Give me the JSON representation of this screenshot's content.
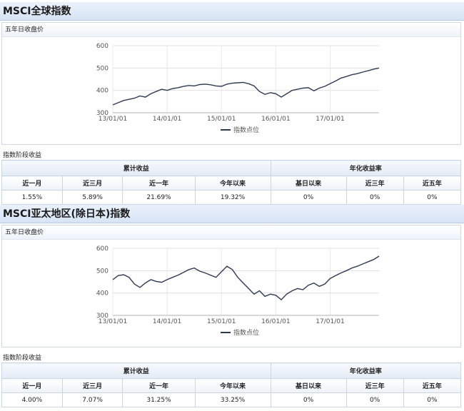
{
  "panels": [
    {
      "title": "MSCI全球指数",
      "chart_title": "五年日收盘价",
      "legend": "指数点位",
      "stage_label": "指数阶段收益",
      "group_cum": "累计收益",
      "group_ann": "年化收益率",
      "headers": [
        "近一月",
        "近三月",
        "近一年",
        "今年以来",
        "基日以来",
        "近三年",
        "近五年"
      ],
      "values": [
        "1.55%",
        "5.89%",
        "21.69%",
        "19.32%",
        "0%",
        "0%",
        "0%"
      ]
    },
    {
      "title": "MSCI亚太地区(除日本)指数",
      "chart_title": "五年日收盘价",
      "legend": "指数点位",
      "stage_label": "指数阶段收益",
      "group_cum": "累计收益",
      "group_ann": "年化收益率",
      "headers": [
        "近一月",
        "近三月",
        "近一年",
        "今年以来",
        "基日以来",
        "近三年",
        "近五年"
      ],
      "values": [
        "4.00%",
        "7.07%",
        "31.25%",
        "33.25%",
        "0%",
        "0%",
        "0%"
      ]
    }
  ],
  "chart_data": [
    {
      "type": "line",
      "title": "五年日收盘价",
      "series_name": "指数点位",
      "ylim": [
        300,
        600
      ],
      "yticks": [
        "300",
        "400",
        "500",
        "600"
      ],
      "xticks": [
        "13/01/01",
        "14/01/01",
        "15/01/01",
        "16/01/01",
        "17/01/01"
      ],
      "xlim": [
        2013.0,
        2017.9
      ],
      "x": [
        2013.0,
        2013.1,
        2013.2,
        2013.3,
        2013.4,
        2013.5,
        2013.6,
        2013.7,
        2013.8,
        2013.9,
        2014.0,
        2014.1,
        2014.2,
        2014.3,
        2014.4,
        2014.5,
        2014.6,
        2014.7,
        2014.8,
        2014.9,
        2015.0,
        2015.1,
        2015.2,
        2015.3,
        2015.4,
        2015.5,
        2015.6,
        2015.7,
        2015.8,
        2015.9,
        2016.0,
        2016.1,
        2016.2,
        2016.3,
        2016.4,
        2016.5,
        2016.6,
        2016.7,
        2016.8,
        2016.9,
        2017.0,
        2017.1,
        2017.2,
        2017.3,
        2017.4,
        2017.5,
        2017.6,
        2017.7,
        2017.8,
        2017.9
      ],
      "y": [
        335,
        345,
        355,
        360,
        365,
        375,
        370,
        385,
        395,
        405,
        400,
        408,
        412,
        418,
        422,
        420,
        426,
        428,
        425,
        420,
        418,
        428,
        432,
        434,
        436,
        430,
        420,
        395,
        382,
        390,
        385,
        370,
        385,
        400,
        405,
        410,
        412,
        398,
        410,
        418,
        430,
        442,
        455,
        462,
        470,
        475,
        482,
        488,
        495,
        500
      ]
    },
    {
      "type": "line",
      "title": "五年日收盘价",
      "series_name": "指数点位",
      "ylim": [
        300,
        600
      ],
      "yticks": [
        "300",
        "400",
        "500",
        "600"
      ],
      "xticks": [
        "13/01/01",
        "14/01/01",
        "15/01/01",
        "16/01/01",
        "17/01/01"
      ],
      "xlim": [
        2013.0,
        2017.9
      ],
      "x": [
        2013.0,
        2013.1,
        2013.2,
        2013.3,
        2013.4,
        2013.5,
        2013.6,
        2013.7,
        2013.8,
        2013.9,
        2014.0,
        2014.1,
        2014.2,
        2014.3,
        2014.4,
        2014.5,
        2014.6,
        2014.7,
        2014.8,
        2014.9,
        2015.0,
        2015.1,
        2015.2,
        2015.3,
        2015.4,
        2015.5,
        2015.6,
        2015.7,
        2015.8,
        2015.9,
        2016.0,
        2016.1,
        2016.2,
        2016.3,
        2016.4,
        2016.5,
        2016.6,
        2016.7,
        2016.8,
        2016.9,
        2017.0,
        2017.1,
        2017.2,
        2017.3,
        2017.4,
        2017.5,
        2017.6,
        2017.7,
        2017.8,
        2017.9
      ],
      "y": [
        460,
        478,
        482,
        470,
        440,
        425,
        445,
        460,
        452,
        448,
        460,
        470,
        480,
        492,
        505,
        512,
        498,
        490,
        480,
        470,
        495,
        520,
        505,
        470,
        445,
        420,
        395,
        410,
        385,
        395,
        390,
        370,
        395,
        410,
        420,
        415,
        435,
        445,
        430,
        440,
        465,
        478,
        490,
        500,
        512,
        520,
        530,
        540,
        550,
        565
      ]
    }
  ]
}
